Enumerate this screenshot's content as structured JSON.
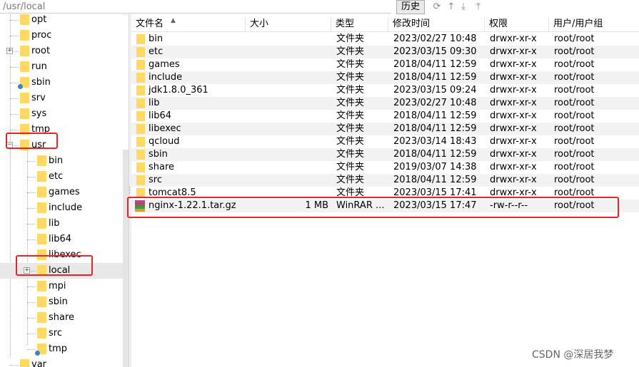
{
  "path_bar": {
    "path": "/usr/local",
    "history_label": "历史",
    "toolbar_icons": [
      "refresh-icon",
      "up-directory-icon",
      "download-icon",
      "upload-icon"
    ]
  },
  "tree": {
    "items": [
      {
        "label": "opt"
      },
      {
        "label": "proc"
      },
      {
        "label": "root"
      },
      {
        "label": "run"
      },
      {
        "label": "sbin"
      },
      {
        "label": "srv"
      },
      {
        "label": "sys"
      },
      {
        "label": "tmp"
      },
      {
        "label": "usr"
      },
      {
        "label": "bin"
      },
      {
        "label": "etc"
      },
      {
        "label": "games"
      },
      {
        "label": "include"
      },
      {
        "label": "lib"
      },
      {
        "label": "lib64"
      },
      {
        "label": "libexec"
      },
      {
        "label": "local"
      },
      {
        "label": "mpi"
      },
      {
        "label": "sbin"
      },
      {
        "label": "share"
      },
      {
        "label": "src"
      },
      {
        "label": "tmp"
      },
      {
        "label": "var"
      }
    ],
    "selected": "local"
  },
  "columns": [
    "文件名",
    "大小",
    "类型",
    "修改时间",
    "权限",
    "用户/用户组"
  ],
  "files": [
    {
      "name": "bin",
      "size": "",
      "type": "文件夹",
      "modified": "2023/02/27 10:48",
      "perm": "drwxr-xr-x",
      "owner": "root/root"
    },
    {
      "name": "etc",
      "size": "",
      "type": "文件夹",
      "modified": "2023/03/15 09:30",
      "perm": "drwxr-xr-x",
      "owner": "root/root"
    },
    {
      "name": "games",
      "size": "",
      "type": "文件夹",
      "modified": "2018/04/11 12:59",
      "perm": "drwxr-xr-x",
      "owner": "root/root"
    },
    {
      "name": "include",
      "size": "",
      "type": "文件夹",
      "modified": "2018/04/11 12:59",
      "perm": "drwxr-xr-x",
      "owner": "root/root"
    },
    {
      "name": "jdk1.8.0_361",
      "size": "",
      "type": "文件夹",
      "modified": "2023/03/15 09:24",
      "perm": "drwxr-xr-x",
      "owner": "root/root"
    },
    {
      "name": "lib",
      "size": "",
      "type": "文件夹",
      "modified": "2023/02/27 10:48",
      "perm": "drwxr-xr-x",
      "owner": "root/root"
    },
    {
      "name": "lib64",
      "size": "",
      "type": "文件夹",
      "modified": "2018/04/11 12:59",
      "perm": "drwxr-xr-x",
      "owner": "root/root"
    },
    {
      "name": "libexec",
      "size": "",
      "type": "文件夹",
      "modified": "2018/04/11 12:59",
      "perm": "drwxr-xr-x",
      "owner": "root/root"
    },
    {
      "name": "qcloud",
      "size": "",
      "type": "文件夹",
      "modified": "2023/03/14 18:43",
      "perm": "drwxr-xr-x",
      "owner": "root/root"
    },
    {
      "name": "sbin",
      "size": "",
      "type": "文件夹",
      "modified": "2018/04/11 12:59",
      "perm": "drwxr-xr-x",
      "owner": "root/root"
    },
    {
      "name": "share",
      "size": "",
      "type": "文件夹",
      "modified": "2019/03/07 14:38",
      "perm": "drwxr-xr-x",
      "owner": "root/root"
    },
    {
      "name": "src",
      "size": "",
      "type": "文件夹",
      "modified": "2018/04/11 12:59",
      "perm": "drwxr-xr-x",
      "owner": "root/root"
    },
    {
      "name": "tomcat8.5",
      "size": "",
      "type": "文件夹",
      "modified": "2023/03/15 17:41",
      "perm": "drwxr-xr-x",
      "owner": "root/root"
    },
    {
      "name": "nginx-1.22.1.tar.gz",
      "size": "1 MB",
      "type": "WinRAR ...",
      "modified": "2023/03/15 17:47",
      "perm": "-rw-r--r--",
      "owner": "root/root"
    }
  ],
  "watermark": "CSDN @深居我梦",
  "colors": {
    "folder": "#ffd966",
    "highlight_box": "#e5252a",
    "row_alt": "#f2f2f2"
  }
}
